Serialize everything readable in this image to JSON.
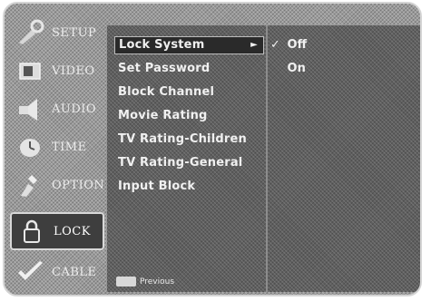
{
  "sidebar": {
    "tabs": [
      {
        "label": "SETUP",
        "icon": "setup-icon",
        "active": false
      },
      {
        "label": "VIDEO",
        "icon": "video-icon",
        "active": false
      },
      {
        "label": "AUDIO",
        "icon": "audio-icon",
        "active": false
      },
      {
        "label": "TIME",
        "icon": "time-icon",
        "active": false
      },
      {
        "label": "OPTION",
        "icon": "option-icon",
        "active": false
      },
      {
        "label": "LOCK",
        "icon": "lock-icon",
        "active": true
      },
      {
        "label": "CABLE",
        "icon": "cable-icon",
        "active": false
      }
    ]
  },
  "menu": {
    "items": [
      {
        "label": "Lock System",
        "arrow": "►"
      },
      {
        "label": "Set Password"
      },
      {
        "label": "Block Channel"
      },
      {
        "label": "Movie Rating"
      },
      {
        "label": "TV Rating-Children"
      },
      {
        "label": "TV Rating-General"
      },
      {
        "label": "Input Block"
      }
    ]
  },
  "options": {
    "items": [
      {
        "check": "✓",
        "label": "Off"
      },
      {
        "check": "",
        "label": "On"
      }
    ]
  },
  "hint": {
    "label": "Previous"
  }
}
